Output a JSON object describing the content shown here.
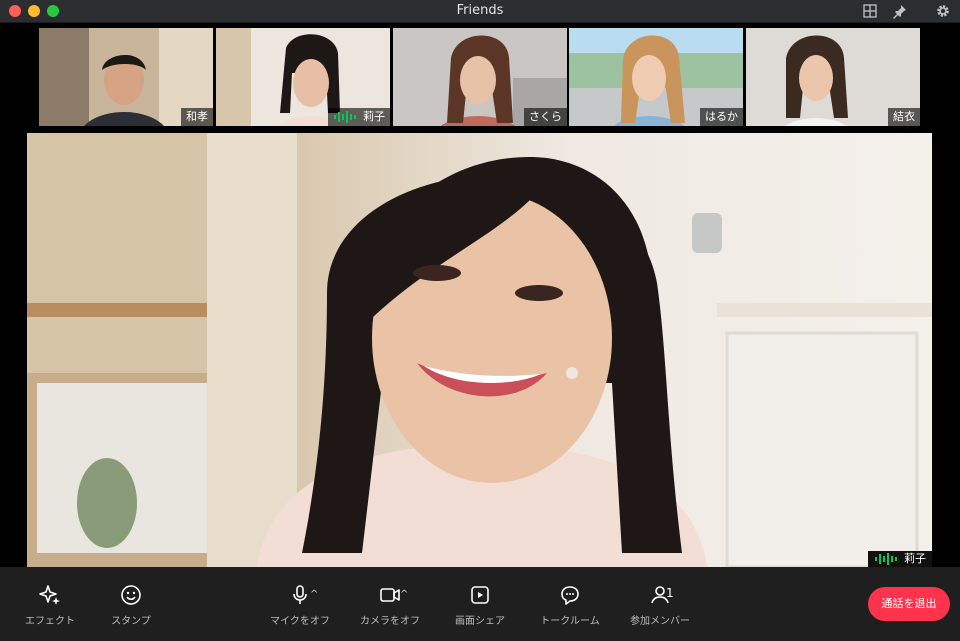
{
  "window": {
    "title": "Friends"
  },
  "participants": [
    {
      "name": "和孝",
      "speaking": false,
      "active": false
    },
    {
      "name": "莉子",
      "speaking": true,
      "active": true
    },
    {
      "name": "さくら",
      "speaking": false,
      "active": false
    },
    {
      "name": "はるか",
      "speaking": false,
      "active": false
    },
    {
      "name": "結衣",
      "speaking": false,
      "active": false
    }
  ],
  "stage": {
    "name": "莉子"
  },
  "toolbar": {
    "effects": "エフェクト",
    "stamps": "スタンプ",
    "mic_off": "マイクをオフ",
    "camera_off": "カメラをオフ",
    "screen_share": "画面シェア",
    "talk_room": "トークルーム",
    "members": "参加メンバー",
    "member_count": "1",
    "leave": "通話を退出"
  },
  "colors": {
    "accent_green": "#06c755",
    "leave_red": "#ff334b"
  }
}
